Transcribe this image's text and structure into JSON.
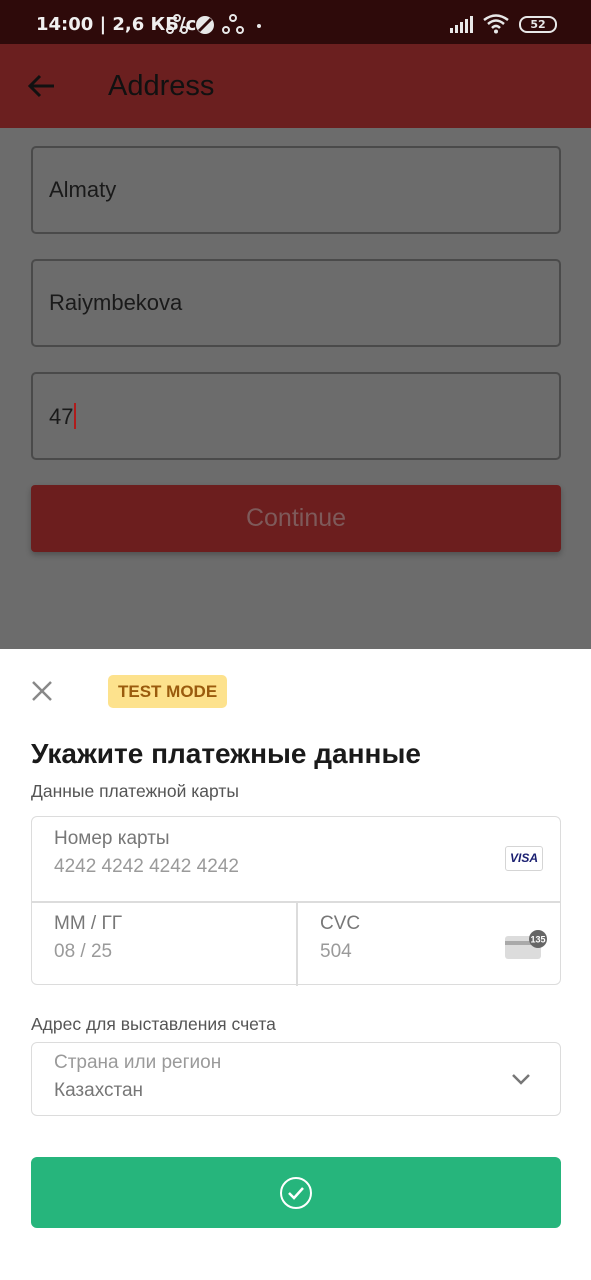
{
  "status_bar": {
    "time_speed": "14:00 | 2,6 КБ/с",
    "battery": "52"
  },
  "app_bar": {
    "title": "Address"
  },
  "address_form": {
    "city": "Almaty",
    "street": "Raiymbekova",
    "house": "47",
    "continue_label": "Continue"
  },
  "payment_sheet": {
    "badge": "TEST MODE",
    "title": "Укажите платежные данные",
    "card_section_label": "Данные платежной карты",
    "card_number_label": "Номер карты",
    "card_number_value": "4242 4242 4242 4242",
    "card_brand": "VISA",
    "expiry_label": "ММ / ГГ",
    "expiry_value": "08 / 25",
    "cvc_label": "CVC",
    "cvc_value": "504",
    "cvc_badge": "135",
    "billing_label": "Адрес для выставления счета",
    "country_label": "Страна или регион",
    "country_value": "Казахстан"
  },
  "colors": {
    "status_bar": "#2e0a0a",
    "app_bar": "#6b1f1f",
    "pay_button": "#26b57c",
    "badge_bg": "#fde28d"
  },
  "icons": {
    "back": "arrow-left-icon",
    "close": "close-icon",
    "chevron": "chevron-down-icon",
    "confirm": "check-circle-icon"
  }
}
